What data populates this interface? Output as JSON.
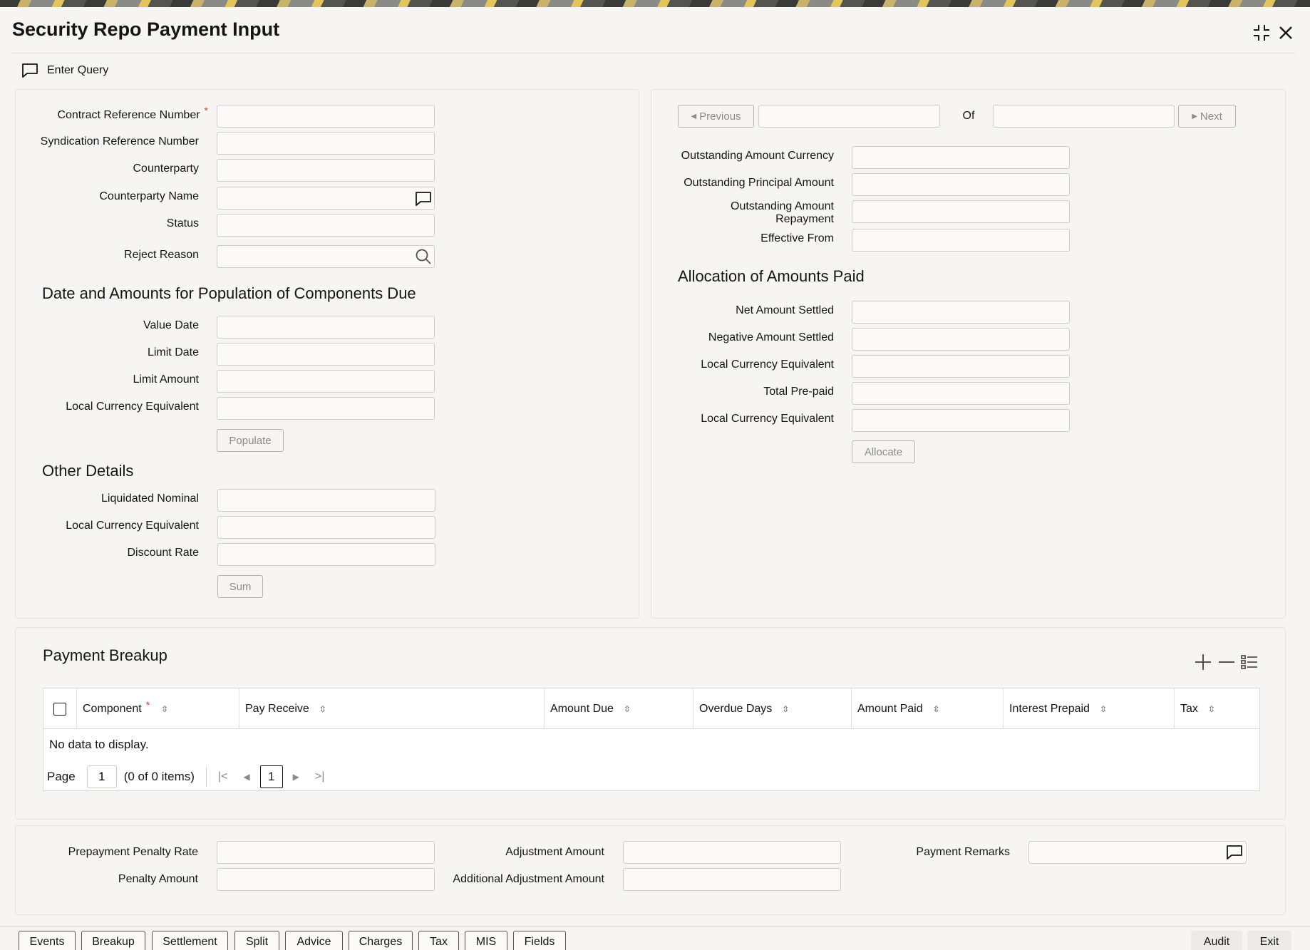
{
  "window": {
    "title": "Security Repo Payment Input"
  },
  "toolbar": {
    "enter_query_label": "Enter Query"
  },
  "left_panel": {
    "contract_ref_label": "Contract Reference Number",
    "contract_ref_required": "*",
    "syndication_ref_label": "Syndication Reference Number",
    "counterparty_label": "Counterparty",
    "counterparty_name_label": "Counterparty Name",
    "status_label": "Status",
    "reject_reason_label": "Reject Reason",
    "date_amounts_heading": "Date and Amounts for Population of Components Due",
    "value_date_label": "Value Date",
    "limit_date_label": "Limit Date",
    "limit_amount_label": "Limit Amount",
    "lce_label_1": "Local Currency Equivalent",
    "populate_label": "Populate",
    "other_details_heading": "Other Details",
    "liquidated_nominal_label": "Liquidated Nominal",
    "lce_label_2": "Local Currency Equivalent",
    "discount_rate_label": "Discount Rate",
    "sum_label": "Sum"
  },
  "right_panel": {
    "previous_label": "Previous",
    "of_label": "Of",
    "next_label": "Next",
    "outstanding_currency_label": "Outstanding Amount Currency",
    "outstanding_principal_label": "Outstanding Principal Amount",
    "outstanding_repayment_label_1": "Outstanding Amount",
    "outstanding_repayment_label_2": "Repayment",
    "effective_from_label": "Effective From",
    "allocation_heading": "Allocation of Amounts Paid",
    "net_settled_label": "Net Amount Settled",
    "negative_settled_label": "Negative Amount Settled",
    "lce_label_1": "Local Currency Equivalent",
    "total_prepaid_label": "Total Pre-paid",
    "lce_label_2": "Local Currency Equivalent",
    "allocate_label": "Allocate"
  },
  "payment_breakup": {
    "heading": "Payment Breakup",
    "columns": [
      "Component",
      "Pay Receive",
      "Amount Due",
      "Overdue Days",
      "Amount Paid",
      "Interest Prepaid",
      "Tax"
    ],
    "component_required": "*",
    "no_data": "No data to display.",
    "page_label": "Page",
    "page_value": "1",
    "items_text": "(0 of 0 items)",
    "current_page": "1"
  },
  "bottom_fields": {
    "prepayment_penalty_rate_label": "Prepayment Penalty Rate",
    "penalty_amount_label": "Penalty Amount",
    "adjustment_amount_label": "Adjustment Amount",
    "additional_adjustment_label": "Additional Adjustment Amount",
    "payment_remarks_label": "Payment Remarks"
  },
  "footer": {
    "buttons": [
      "Events",
      "Breakup",
      "Settlement",
      "Split",
      "Advice",
      "Charges",
      "Tax",
      "MIS",
      "Fields"
    ],
    "audit_label": "Audit",
    "exit_label": "Exit"
  },
  "colors": {
    "required": "#c74634",
    "text": "#161513",
    "background": "#f6f5f3"
  }
}
